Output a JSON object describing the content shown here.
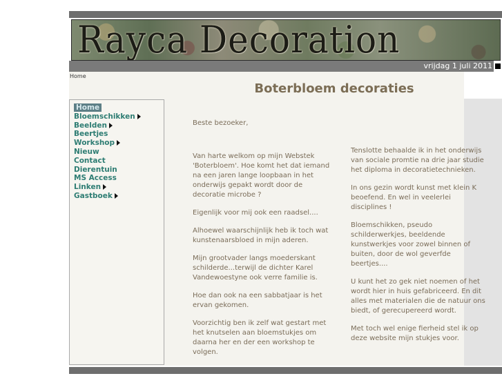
{
  "header": {
    "brand": "Rayca Decoration",
    "date": "vrijdag 1 juli 2011"
  },
  "breadcrumb": "Home",
  "page_title": "Boterbloem decoraties",
  "menu": [
    {
      "label": "Home",
      "has_sub": false,
      "active": true
    },
    {
      "label": "Bloemschikken",
      "has_sub": true
    },
    {
      "label": "Beelden",
      "has_sub": true
    },
    {
      "label": "Beertjes",
      "has_sub": false
    },
    {
      "label": "Workshop",
      "has_sub": true
    },
    {
      "label": "Nieuw",
      "has_sub": false
    },
    {
      "label": "Contact",
      "has_sub": false
    },
    {
      "label": "Dierentuin",
      "has_sub": false
    },
    {
      "label": "MS Access",
      "has_sub": false
    },
    {
      "label": "Linken",
      "has_sub": true
    },
    {
      "label": "Gastboek",
      "has_sub": true
    }
  ],
  "greeting": "Beste bezoeker,",
  "col1": [
    "Van harte welkom op mijn Webstek 'Boterbloem'. Hoe komt het dat iemand na een jaren lange loopbaan in het onderwijs gepakt wordt door de decoratie microbe ?",
    "Eigenlijk voor mij ook een raadsel....",
    "Alhoewel waarschijnlijk heb ik toch wat kunstenaarsbloed in mijn aderen.",
    "Mijn grootvader langs moederskant schilderde...terwijl de dichter Karel Vandewoestyne ook verre familie is.",
    "Hoe dan ook na een sabbatjaar is het ervan gekomen.",
    "Voorzichtig ben ik zelf wat gestart met het knutselen aan bloemstukjes om daarna her en der een workshop te volgen."
  ],
  "col2": [
    "Tenslotte behaalde ik in het onderwijs van sociale promtie na drie jaar studie het diploma in decoratietechnieken.",
    "In ons gezin wordt kunst met klein K beoefend. En wel in veelerlei disciplines !",
    "Bloemschikken, pseudo schilderwerkjes, beeldende kunstwerkjes voor zowel binnen of buiten, door de wol geverfde beertjes....",
    "U kunt het zo gek niet noemen of het wordt hier in huis gefabriceerd. En dit alles met materialen die de natuur ons biedt, of gerecupereerd wordt.",
    "Met toch wel enige fierheid stel ik op deze website mijn stukjes voor."
  ]
}
